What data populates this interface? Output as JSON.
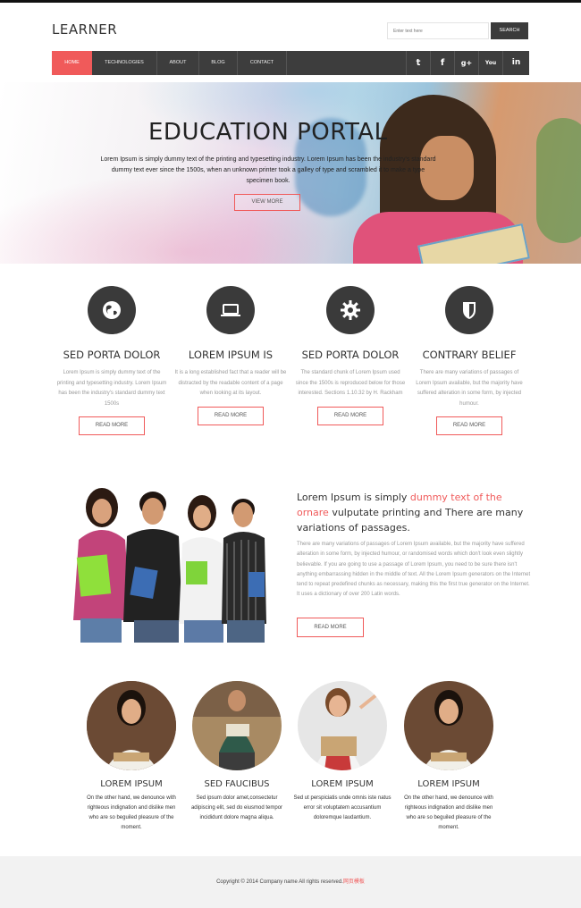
{
  "header": {
    "logo": "LEARNER",
    "search_placeholder": "Enter text here",
    "search_button": "SEARCH"
  },
  "nav": {
    "items": [
      {
        "label": "HOME",
        "active": true
      },
      {
        "label": "TECHNOLOGIES",
        "active": false
      },
      {
        "label": "ABOUT",
        "active": false
      },
      {
        "label": "BLOG",
        "active": false
      },
      {
        "label": "CONTACT",
        "active": false
      }
    ],
    "social": [
      {
        "icon": "twitter-icon",
        "glyph": "t"
      },
      {
        "icon": "facebook-icon",
        "glyph": "f"
      },
      {
        "icon": "google-plus-icon",
        "glyph": "g+"
      },
      {
        "icon": "youtube-icon",
        "glyph": "You"
      },
      {
        "icon": "linkedin-icon",
        "glyph": "in"
      }
    ]
  },
  "hero": {
    "title": "EDUCATION PORTAL",
    "text": "Lorem Ipsum is simply dummy text of the printing and typesetting industry. Lorem Ipsum has been the industry's standard dummy text ever since the 1500s, when an unknown printer took a galley of type and scrambled it to make a type specimen book.",
    "button": "VIEW MORE"
  },
  "features": [
    {
      "icon": "globe-icon",
      "title": "SED PORTA DOLOR",
      "text": "Lorem Ipsum is simply dummy text of the printing and typesetting industry. Lorem Ipsum has been the industry's standard dummy text 1500s",
      "button": "READ MORE"
    },
    {
      "icon": "laptop-icon",
      "title": "LOREM IPSUM IS",
      "text": "It is a long established fact that a reader will be distracted by the readable content of a page when looking at its layout.",
      "button": "READ MORE"
    },
    {
      "icon": "gear-icon",
      "title": "SED PORTA DOLOR",
      "text": "The standard chunk of Lorem Ipsum used since the 1500s is reproduced below for those interested. Sections 1.10.32 by H. Rackham",
      "button": "READ MORE"
    },
    {
      "icon": "shield-icon",
      "title": "CONTRARY BELIEF",
      "text": "There are many variations of passages of Lorem Ipsum available, but the majority have suffered alteration in some form, by injected humour.",
      "button": "READ MORE"
    }
  ],
  "about": {
    "title_part1": "Lorem Ipsum is simply ",
    "title_highlight": "dummy text of the ornare",
    "title_part2": " vulputate printing and There are many variations of passages.",
    "text": "There are many variations of passages of Lorem Ipsum available, but the majority have suffered alteration in some form, by injected humour, or randomised words which don't look even slightly believable. If you are going to use a passage of Lorem Ipsum, you need to be sure there isn't anything embarrassing hidden in the middle of text. All the Lorem Ipsum generators on the Internet tend to repeat predefined chunks as necessary, making this the first true generator on the Internet. It uses a dictionary of over 200 Latin words.",
    "button": "READ MORE"
  },
  "team": [
    {
      "name": "LOREM IPSUM",
      "text": "On the other hand, we denounce with righteous indignation and dislike men who are so beguiled pleasure of the moment."
    },
    {
      "name": "SED FAUCIBUS",
      "text": "Sed ipsum dolor amet,consectetur adipiscing elit, sed do eiusmod tempor incididunt dolore magna aliqua."
    },
    {
      "name": "LOREM IPSUM",
      "text": "Sed ut perspiciatis unde omnis iste natus error sit voluptatem accusantium doloremque laudantium."
    },
    {
      "name": "LOREM IPSUM",
      "text": "On the other hand, we denounce with righteous indignation and dislike men who are so beguiled pleasure of the moment."
    }
  ],
  "footer": {
    "text": "Copyright © 2014 Company name All rights reserved.",
    "link": "网页模板"
  },
  "colors": {
    "accent": "#f05a5a",
    "dark": "#3d3d3d"
  }
}
